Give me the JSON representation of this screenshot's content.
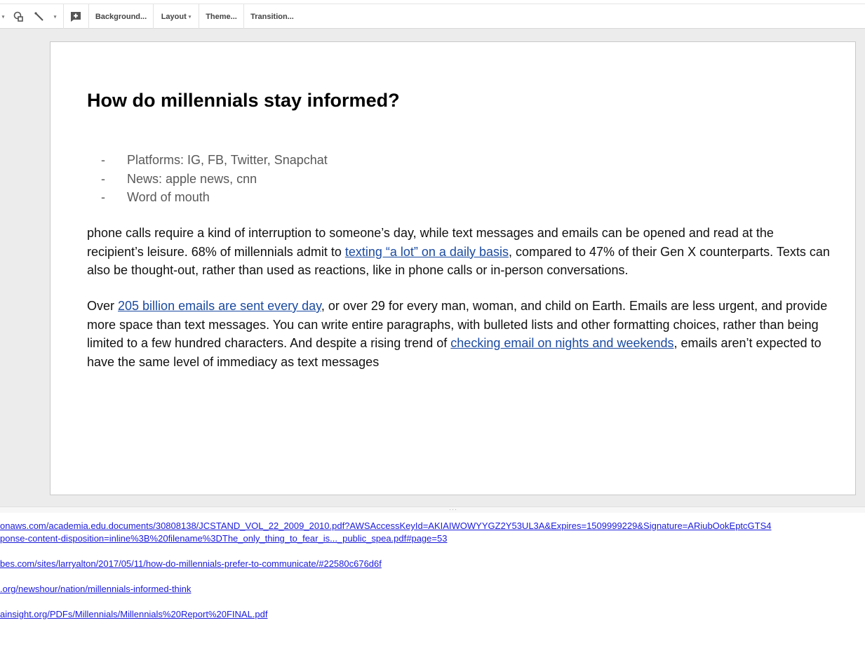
{
  "toolbar": {
    "background_label": "Background...",
    "layout_label": "Layout",
    "theme_label": "Theme...",
    "transition_label": "Transition..."
  },
  "slide": {
    "title": "How do millennials stay informed?",
    "bullets": [
      "Platforms: IG, FB, Twitter, Snapchat",
      "News: apple news, cnn",
      "Word of mouth"
    ],
    "bullet_marker": "-",
    "para1": {
      "text1": "phone calls require a kind of interruption to someone’s day, while text messages and emails can be opened and read at the recipient’s leisure. 68% of millennials admit to ",
      "link1": "texting “a lot” on a daily basis",
      "text2": ", compared to 47% of their Gen X counterparts. Texts can also be thought-out, rather than used as reactions, like in phone calls or in-person conversations."
    },
    "para2": {
      "text1": "Over ",
      "link1": "205 billion emails are sent every day",
      "text2": ", or over 29 for every man, woman, and child on Earth. Emails are less urgent, and provide more space than text messages. You can write entire paragraphs, with bulleted lists and other formatting choices, rather than being limited to a few hundred characters. And despite a rising trend of ",
      "link2": "checking email on nights and weekends",
      "text3": ", emails aren’t expected to have the same level of immediacy as text messages"
    }
  },
  "speaker_notes": {
    "links": [
      "onaws.com/academia.edu.documents/30808138/JCSTAND_VOL_22_2009_2010.pdf?AWSAccessKeyId=AKIAIWOWYYGZ2Y53UL3A&Expires=1509999229&Signature=ARiubOokEptcGTS4",
      "ponse-content-disposition=inline%3B%20filename%3DThe_only_thing_to_fear_is..._public_spea.pdf#page=53",
      "bes.com/sites/larryalton/2017/05/11/how-do-millennials-prefer-to-communicate/#22580c676d6f",
      ".org/newshour/nation/millennials-informed-think",
      "ainsight.org/PDFs/Millennials/Millennials%20Report%20FINAL.pdf"
    ]
  },
  "colors": {
    "link": "#1a4aa0",
    "note_link": "#1a1adc",
    "editor_background": "#ececec"
  }
}
